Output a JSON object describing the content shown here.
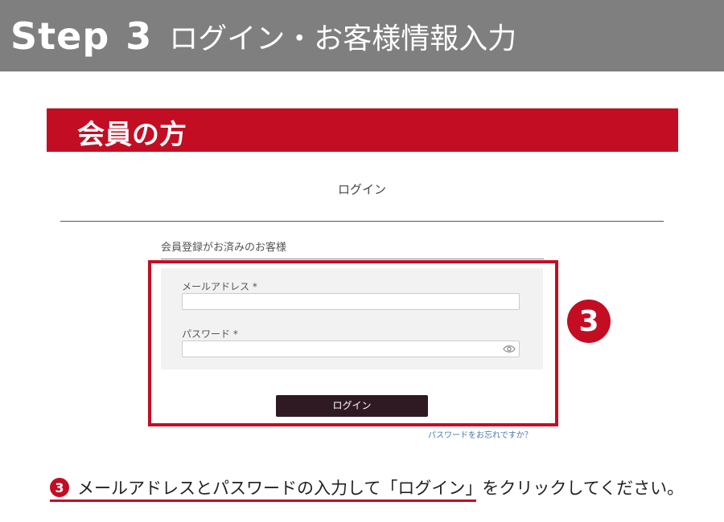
{
  "header": {
    "step_label": "Step",
    "step_number": "3",
    "title": "ログイン・お客様情報入力"
  },
  "banner": {
    "label": "会員の方"
  },
  "page": {
    "heading": "ログイン"
  },
  "login_form": {
    "section_title": "会員登録がお済みのお客様",
    "email_label": "メールアドレス *",
    "email_value": "",
    "password_label": "パスワード *",
    "password_value": "",
    "password_toggle_icon": "eye-icon",
    "login_button": "ログイン",
    "forgot_link": "パスワードをお忘れですか？"
  },
  "annotation": {
    "badge": "3",
    "instruction_badge": "3",
    "instruction": "メールアドレスとパスワードの入力して「ログイン」をクリックしてください。"
  },
  "colors": {
    "header_bg": "#7f7f7f",
    "accent_red": "#c30d23",
    "button_bg": "#2f1a23",
    "panel_bg": "#f2f2f2",
    "link": "#4a78b0"
  }
}
